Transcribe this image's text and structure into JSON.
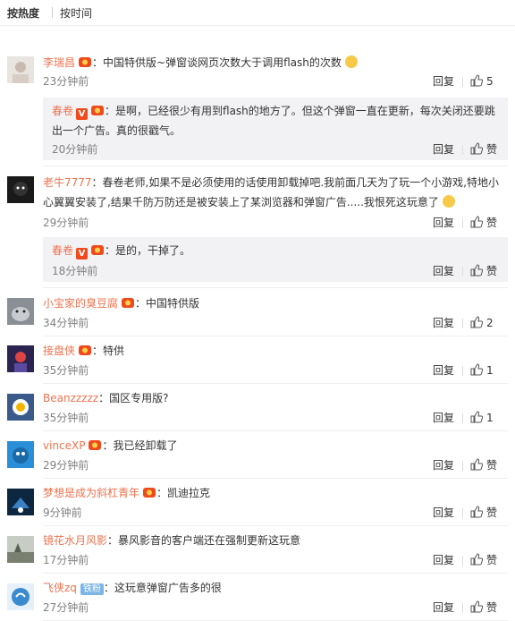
{
  "sort": {
    "hot": "按热度",
    "time": "按时间"
  },
  "labels": {
    "reply": "回复",
    "like": "赞"
  },
  "colors": {
    "name": "#eb7350",
    "sub_bg": "#f2f2f5",
    "vip": "#f04a1c"
  },
  "comments": [
    {
      "name": "李瑞昌",
      "text": "：中国特供版~弹窗谈网页次数大于调用flash的次数",
      "time": "23分钟前",
      "likes": "5",
      "reply": {
        "name": "春卷",
        "text": "：是啊，已经很少有用到flash的地方了。但这个弹窗一直在更新，每次关闭还要跳出一个广告。真的很戳气。",
        "time": "20分钟前",
        "likes": "赞"
      }
    },
    {
      "name": "老牛7777",
      "text": "：春卷老师,如果不是必须使用的话使用卸载掉吧.我前面几天为了玩一个小游戏,特地小心翼翼安装了,结果千防万防还是被安装上了某浏览器和弹窗广告.....我恨死这玩意了",
      "time": "29分钟前",
      "likes": "赞",
      "reply": {
        "name": "春卷",
        "text": "：是的，干掉了。",
        "time": "18分钟前",
        "likes": "赞"
      }
    },
    {
      "name": "小宝家的臭豆腐",
      "text": "：中国特供版",
      "time": "34分钟前",
      "likes": "2"
    },
    {
      "name": "接盘侠",
      "text": "：特供",
      "time": "35分钟前",
      "likes": "1"
    },
    {
      "name": "Beanzzzzz",
      "text": "：国区专用版?",
      "time": "35分钟前",
      "likes": "1"
    },
    {
      "name": "vinceXP",
      "text": "：我已经卸载了",
      "time": "29分钟前",
      "likes": "赞"
    },
    {
      "name": "梦想是成为斜杠青年",
      "text": "：凯迪拉克",
      "time": "9分钟前",
      "likes": "赞"
    },
    {
      "name": "镜花水月风影",
      "text": "：暴风影音的客户端还在强制更新这玩意",
      "time": "17分钟前",
      "likes": "赞"
    },
    {
      "name": "飞侠zq",
      "badge": "铁粉",
      "text": "：这玩意弹窗广告多的很",
      "time": "27分钟前",
      "likes": "赞"
    }
  ]
}
